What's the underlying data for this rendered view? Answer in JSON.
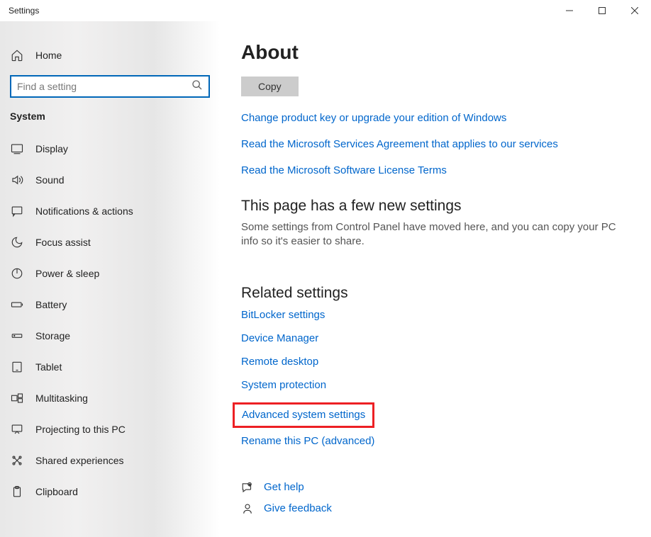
{
  "window": {
    "title": "Settings"
  },
  "sidebar": {
    "home_label": "Home",
    "search_placeholder": "Find a setting",
    "category_label": "System",
    "items": [
      {
        "label": "Display",
        "icon": "display-icon"
      },
      {
        "label": "Sound",
        "icon": "sound-icon"
      },
      {
        "label": "Notifications & actions",
        "icon": "notifications-icon"
      },
      {
        "label": "Focus assist",
        "icon": "focus-assist-icon"
      },
      {
        "label": "Power & sleep",
        "icon": "power-icon"
      },
      {
        "label": "Battery",
        "icon": "battery-icon"
      },
      {
        "label": "Storage",
        "icon": "storage-icon"
      },
      {
        "label": "Tablet",
        "icon": "tablet-icon"
      },
      {
        "label": "Multitasking",
        "icon": "multitasking-icon"
      },
      {
        "label": "Projecting to this PC",
        "icon": "projecting-icon"
      },
      {
        "label": "Shared experiences",
        "icon": "shared-icon"
      },
      {
        "label": "Clipboard",
        "icon": "clipboard-icon"
      }
    ]
  },
  "content": {
    "page_title": "About",
    "copy_label": "Copy",
    "primary_links": [
      "Change product key or upgrade your edition of Windows",
      "Read the Microsoft Services Agreement that applies to our services",
      "Read the Microsoft Software License Terms"
    ],
    "section_heading": "This page has a few new settings",
    "section_text": "Some settings from Control Panel have moved here, and you can copy your PC info so it's easier to share.",
    "related_heading": "Related settings",
    "related_links": [
      {
        "label": "BitLocker settings",
        "highlighted": false
      },
      {
        "label": "Device Manager",
        "highlighted": false
      },
      {
        "label": "Remote desktop",
        "highlighted": false
      },
      {
        "label": "System protection",
        "highlighted": false
      },
      {
        "label": "Advanced system settings",
        "highlighted": true
      },
      {
        "label": "Rename this PC (advanced)",
        "highlighted": false
      }
    ],
    "footer_links": [
      {
        "label": "Get help",
        "icon": "help-icon"
      },
      {
        "label": "Give feedback",
        "icon": "feedback-icon"
      }
    ]
  }
}
